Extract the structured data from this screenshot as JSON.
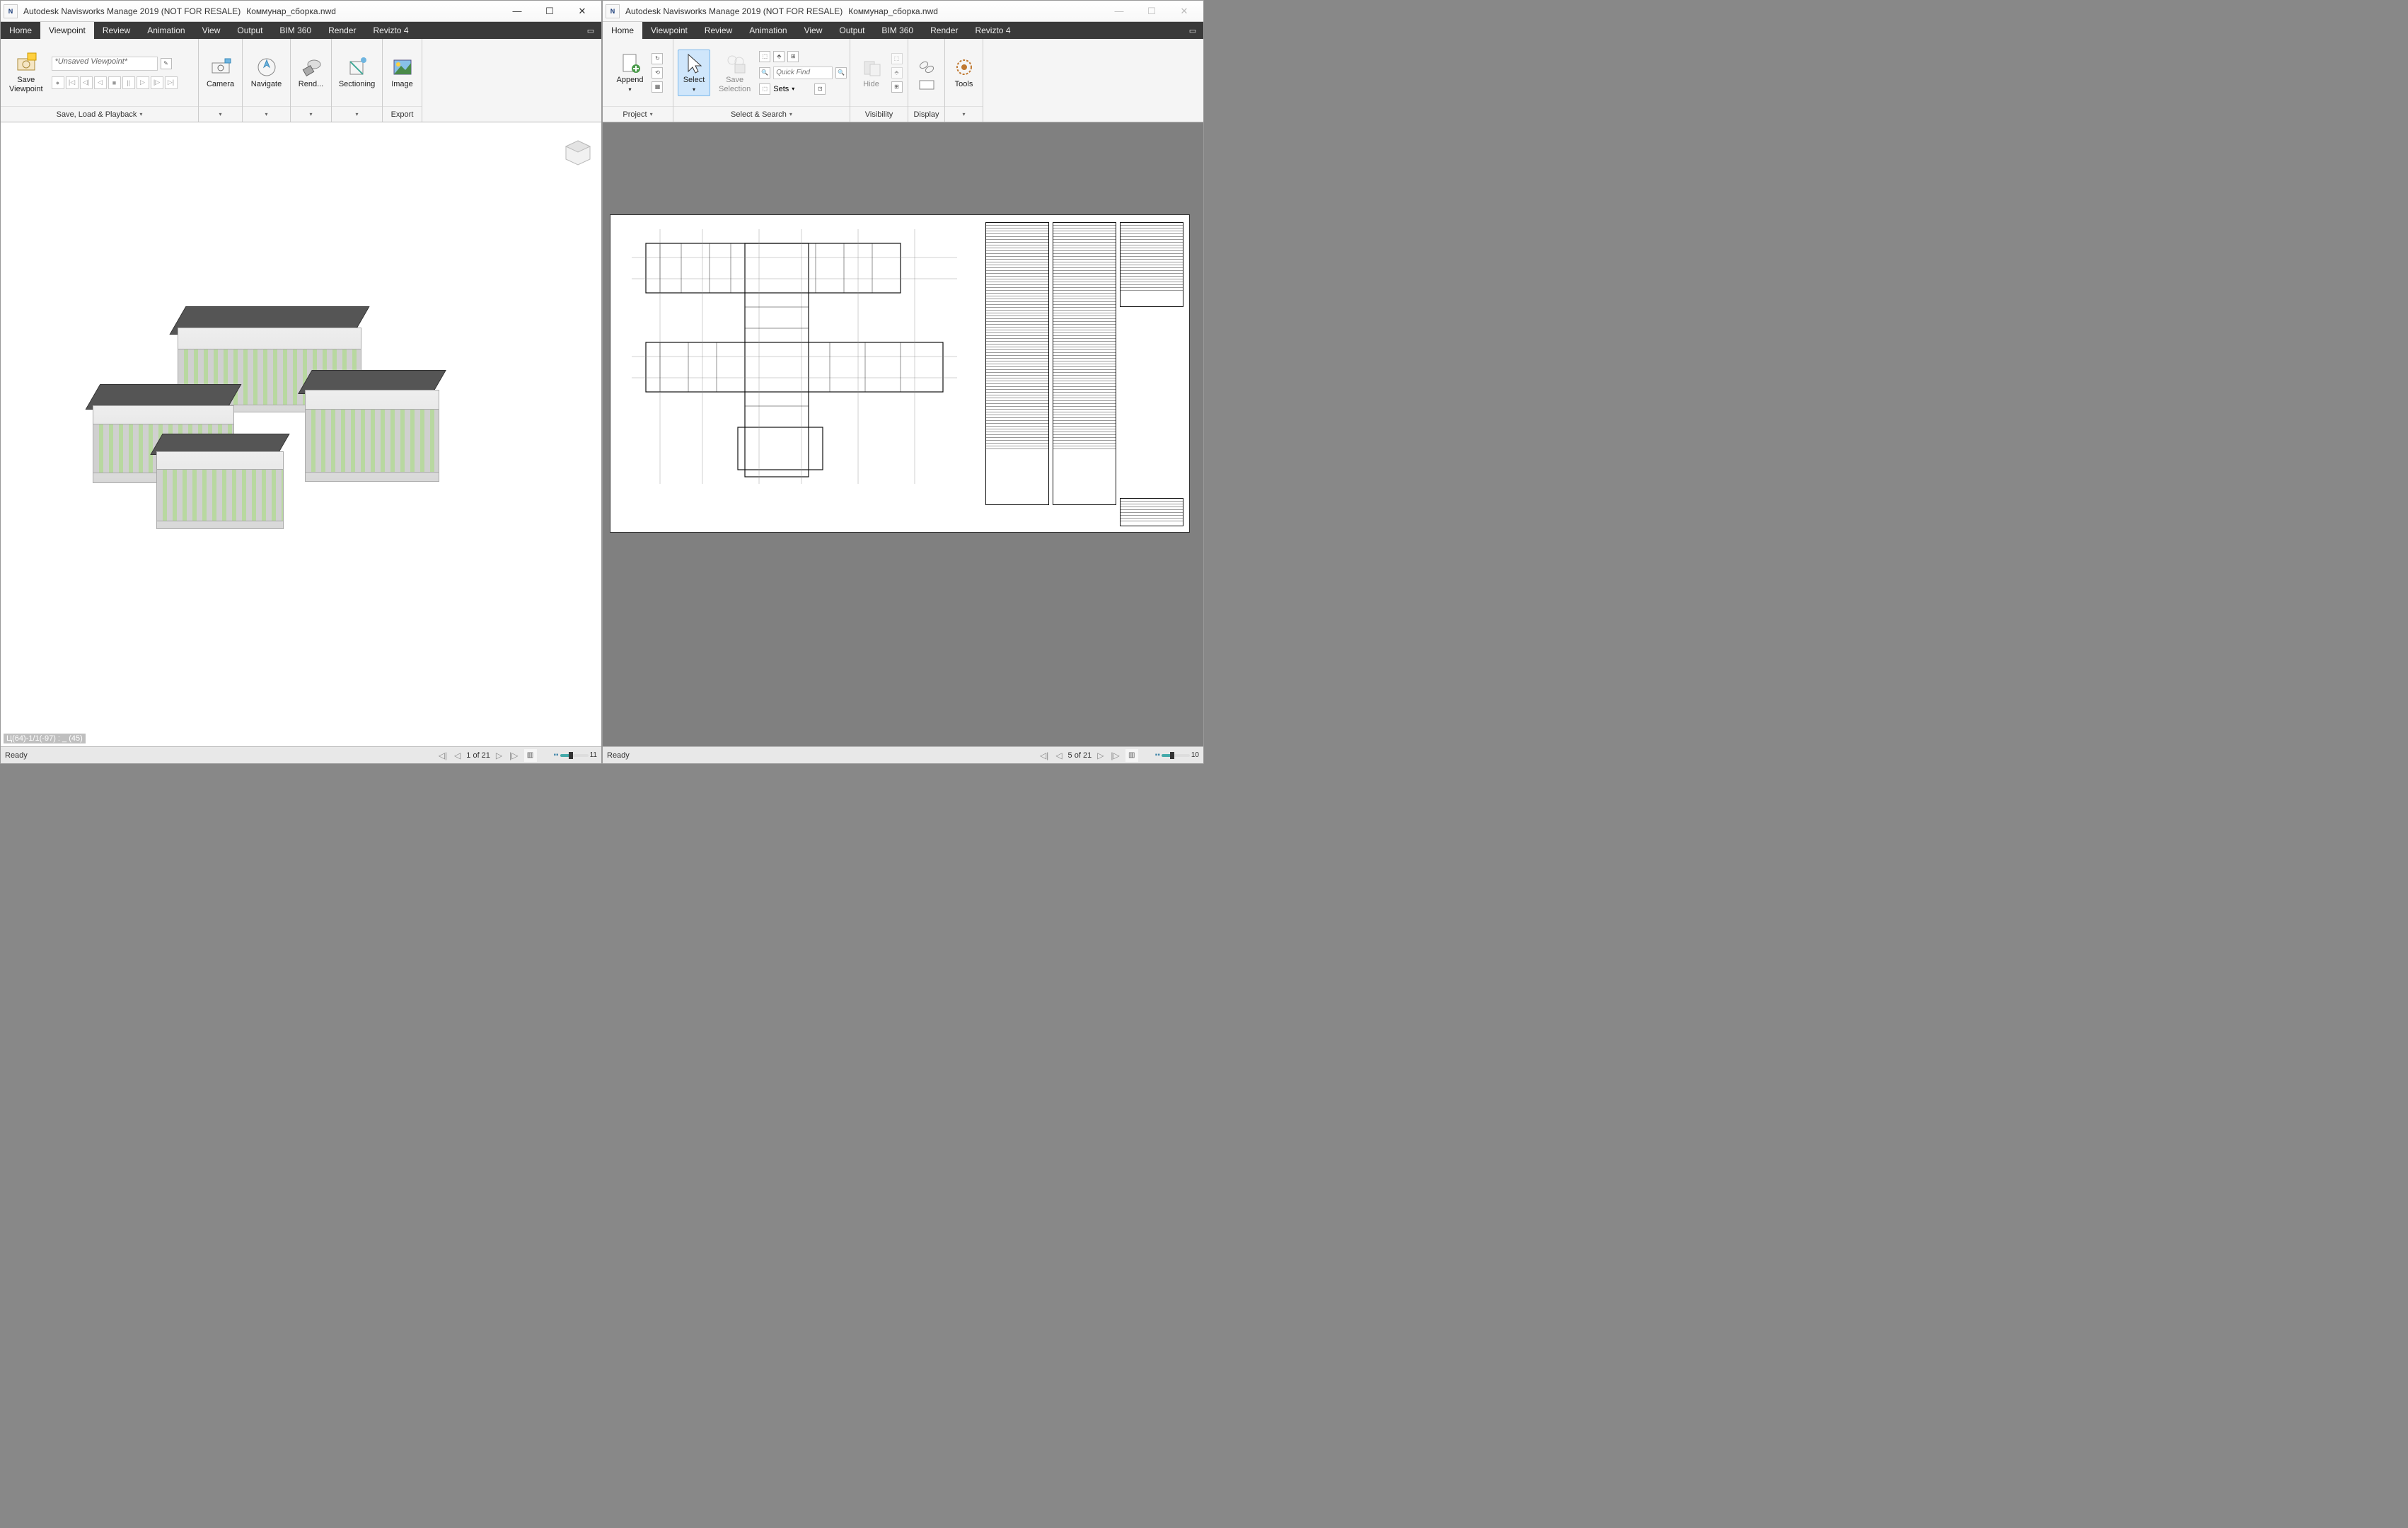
{
  "appA": {
    "icon": "N",
    "title": "Autodesk Navisworks Manage 2019 (NOT FOR RESALE)",
    "doc": "Коммунар_сборка.nwd",
    "tabs": [
      "Home",
      "Viewpoint",
      "Review",
      "Animation",
      "View",
      "Output",
      "BIM 360",
      "Render",
      "Revizto 4"
    ],
    "active_tab": "Viewpoint",
    "ribbon": {
      "save_viewpoint": "Save\nViewpoint",
      "combo": "*Unsaved Viewpoint*",
      "panel_save": "Save, Load & Playback",
      "camera": "Camera",
      "navigate": "Navigate",
      "render": "Rend...",
      "sectioning": "Sectioning",
      "image": "Image",
      "export": "Export"
    },
    "coord": "Ц(64)-1/1(-97) : _ (45)",
    "status_ready": "Ready",
    "pager": "1 of 21",
    "slider_val": "11"
  },
  "appB": {
    "icon": "N",
    "title": "Autodesk Navisworks Manage 2019 (NOT FOR RESALE)",
    "doc": "Коммунар_сборка.nwd",
    "tabs": [
      "Home",
      "Viewpoint",
      "Review",
      "Animation",
      "View",
      "Output",
      "BIM 360",
      "Render",
      "Revizto 4"
    ],
    "active_tab": "Home",
    "ribbon": {
      "append": "Append",
      "project": "Project",
      "select": "Select",
      "save_sel": "Save\nSelection",
      "quickfind": "Quick Find",
      "sets": "Sets",
      "select_search": "Select & Search",
      "hide": "Hide",
      "visibility": "Visibility",
      "display": "Display",
      "tools": "Tools"
    },
    "status_ready": "Ready",
    "pager": "5 of 21",
    "slider_val": "10"
  }
}
